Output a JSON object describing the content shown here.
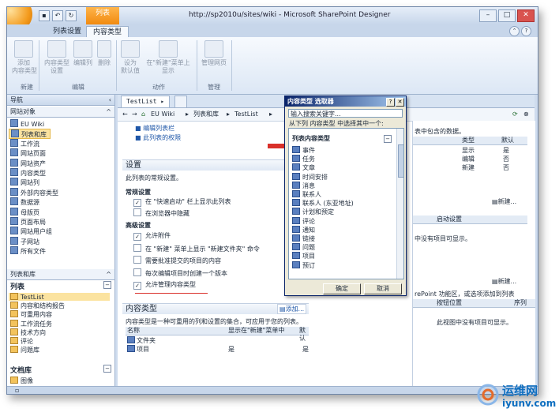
{
  "window": {
    "title": "http://sp2010u/sites/wiki - Microsoft SharePoint Designer",
    "context_tab": "列表",
    "controls": {
      "minimize": "–",
      "maximize": "□",
      "close": "✕"
    }
  },
  "ribbon": {
    "tabs": [
      "列表设置",
      "内容类型"
    ],
    "buttons": [
      {
        "label": "添加\n内容类型",
        "icon": "add-content-type-icon"
      },
      {
        "label": "内容类型\n设置",
        "icon": "content-type-settings-icon"
      },
      {
        "label": "编辑列",
        "icon": "edit-columns-icon"
      },
      {
        "label": "删除",
        "icon": "delete-icon"
      },
      {
        "label": "设为\n默认值",
        "icon": "set-default-icon"
      },
      {
        "label": "在\"新建\"菜单上\n显示",
        "icon": "show-on-new-menu-icon"
      },
      {
        "label": "管理网页",
        "icon": "manage-pages-icon"
      }
    ],
    "groups": [
      "新建",
      "编辑",
      "动作",
      "管理"
    ]
  },
  "nav": {
    "header": "导航",
    "site_objects_header": "网站对象",
    "site_objects": [
      "EU Wiki",
      "列表和库",
      "工作流",
      "网站页面",
      "网站资产",
      "内容类型",
      "网站列",
      "外部内容类型",
      "数据源",
      "母版页",
      "页面布局",
      "网站用户组",
      "子网站",
      "所有文件"
    ],
    "lists_section_header": "列表和库",
    "lists_header": "列表",
    "lists": [
      "TestList",
      "内容和结构报告",
      "可重用内容",
      "工作流任务",
      "技术方向",
      "评论",
      "问题库"
    ],
    "doclib_header": "文档库",
    "doclibs": [
      "图像"
    ]
  },
  "main": {
    "doc_tab": "TestList",
    "breadcrumb": [
      "EU Wiki",
      "列表和库",
      "TestList"
    ],
    "links": [
      "编辑列表栏",
      "此列表的权限"
    ],
    "settings": {
      "title": "设置",
      "description": "此列表的常规设置。",
      "general_header": "常规设置",
      "general": [
        {
          "label": "在 \"快速启动\" 栏上显示此列表",
          "checked": true
        },
        {
          "label": "在浏览器中隐藏",
          "checked": false
        }
      ],
      "advanced_header": "高级设置",
      "advanced": [
        {
          "label": "允许附件",
          "checked": true
        },
        {
          "label": "在 \"新建\" 菜单上显示 \"新建文件夹\" 命令",
          "checked": false
        },
        {
          "label": "需要批准提交的项目的内容",
          "checked": false
        },
        {
          "label": "每次编辑项目时创建一个版本",
          "checked": false
        },
        {
          "label": "允许管理内容类型",
          "checked": true
        }
      ]
    },
    "content_types": {
      "title": "内容类型",
      "add_label": "添加...",
      "description": "内容类型是一种可重用的列和设置的集合，可应用于您的列表。",
      "columns": [
        "名称",
        "显示在\"新建\"菜单中",
        "默认"
      ],
      "rows": [
        {
          "name": "文件夹",
          "shown": "",
          "default": ""
        },
        {
          "name": "项目",
          "shown": "是",
          "default": "是"
        }
      ]
    }
  },
  "right": {
    "desc": "表中包含的数据。",
    "columns": [
      "类型",
      "默认"
    ],
    "rows": [
      {
        "type": "显示",
        "default": "是"
      },
      {
        "type": "编辑",
        "default": "否"
      },
      {
        "type": "新建",
        "default": "否"
      }
    ],
    "new_label": "新建...",
    "workflow_col": "启动设置",
    "empty_msg": "中没有项目可显示。",
    "new_label2": "新建...",
    "ribbon_msg": "rePoint 功能区，或选项添加到列表",
    "button_col": "按钮位置",
    "seq_col": "序列",
    "empty_msg2": "此视图中没有项目可显示。"
  },
  "dialog": {
    "title": "内容类型 选取器",
    "help": "?",
    "close": "✕",
    "search_placeholder": "输入搜索关键字...",
    "prompt": "从下列 内容类型 中选择其中一个:",
    "group_header": "列表内容类型",
    "items": [
      "事件",
      "任务",
      "文章",
      "时间安排",
      "消息",
      "联系人",
      "联系人 (东亚地址)",
      "计划和预定",
      "评论",
      "通知",
      "链接",
      "问题",
      "项目",
      "预订"
    ],
    "ok": "确定",
    "cancel": "取消"
  },
  "watermark": {
    "brand": "运维网",
    "url": "iyunv.com"
  }
}
